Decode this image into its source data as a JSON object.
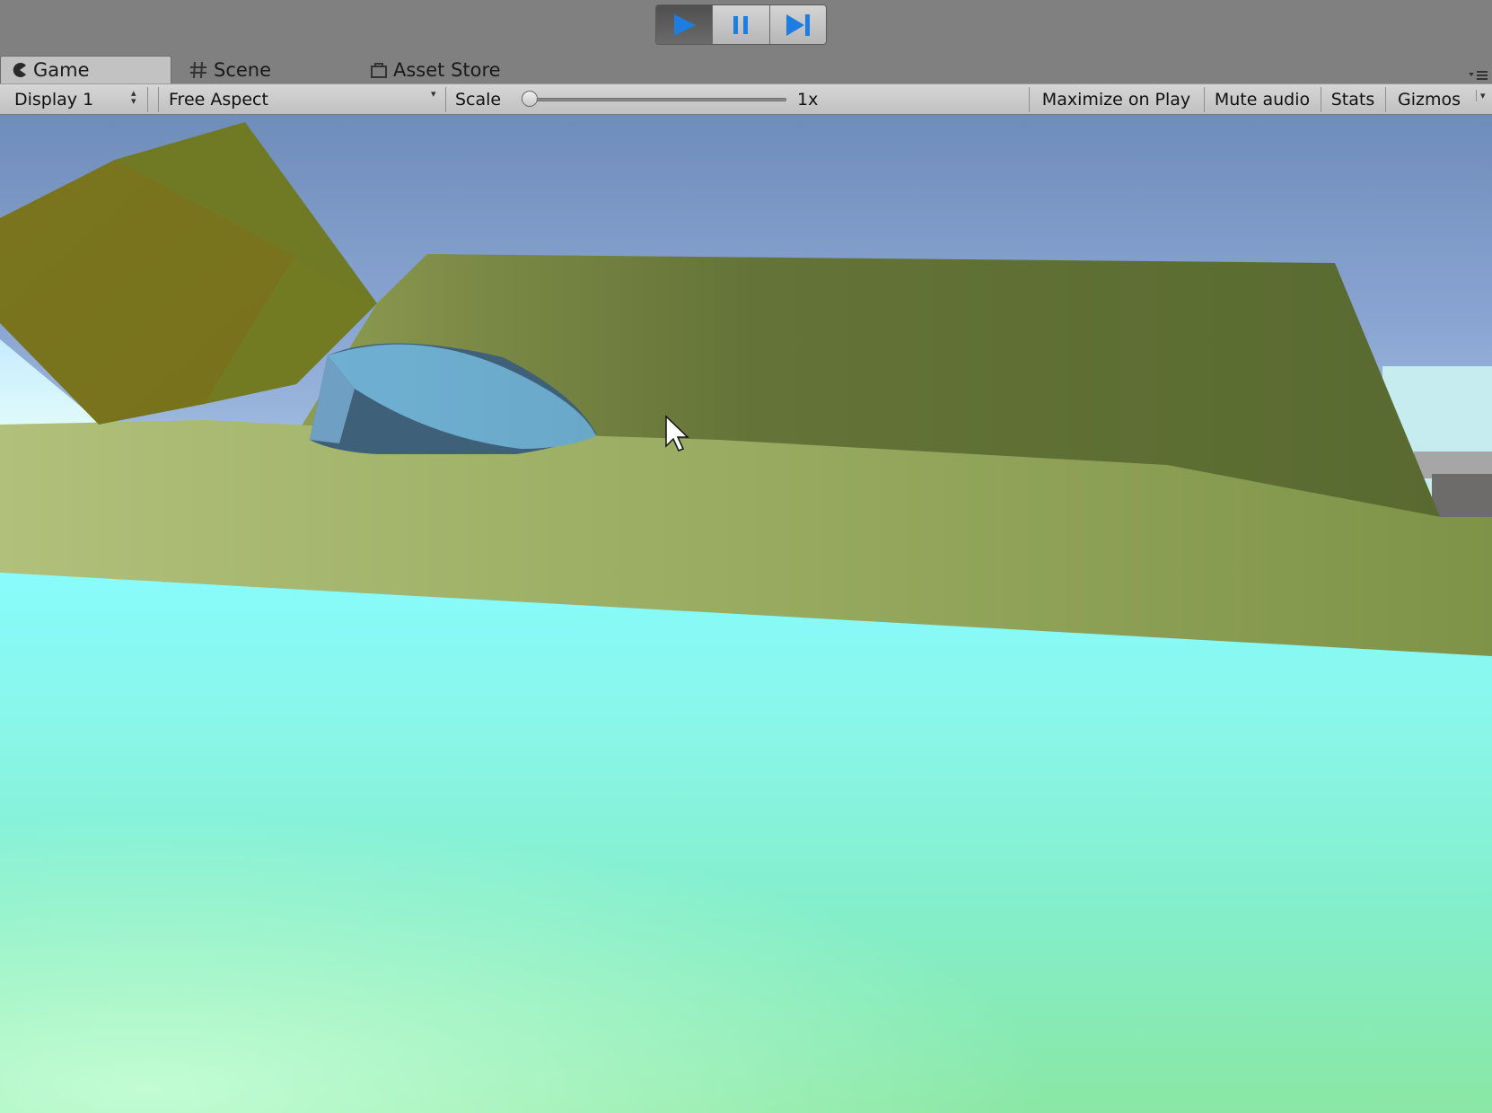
{
  "play_controls": {
    "play": {
      "icon": "play-icon",
      "state": "active"
    },
    "pause": {
      "icon": "pause-icon"
    },
    "step": {
      "icon": "step-icon"
    },
    "accent_color": "#1e7de0"
  },
  "tabs": [
    {
      "label": "Game",
      "icon": "pacman-game-icon",
      "active": true
    },
    {
      "label": "Scene",
      "icon": "hash-icon",
      "active": false
    },
    {
      "label": "Asset Store",
      "icon": "shopping-bag-icon",
      "active": false
    }
  ],
  "game_toolbar": {
    "display": "Display 1",
    "aspect": "Free Aspect",
    "scale_label": "Scale",
    "scale_value_text": "1x",
    "scale_value": 0,
    "maximize_on_play": "Maximize on Play",
    "mute_audio": "Mute audio",
    "stats": "Stats",
    "gizmos": "Gizmos"
  },
  "viewport": {
    "sky_top": "#6e8bb6",
    "sky_bottom": "#9fb8e4",
    "cube_color": "#7a7a1a",
    "wall_color": "#5e6e34",
    "ground_color": "#9aae62",
    "cylinder_color": "#6aa8c8",
    "water_top": "#87fafa",
    "water_bottom": "#86e6a6"
  }
}
